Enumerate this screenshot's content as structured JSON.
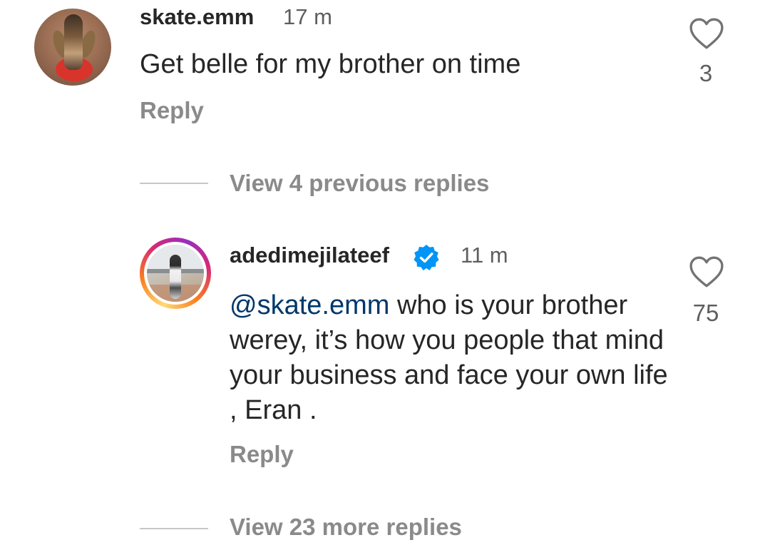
{
  "comments": [
    {
      "username": "skate.emm",
      "time": "17 m",
      "text": "Get belle for my brother on time",
      "reply_label": "Reply",
      "likes": "3",
      "verified": false
    },
    {
      "username": "adedimejilateef",
      "time": "11 m",
      "mention": "@skate.emm",
      "text": " who is your brother werey, it’s how you people that mind your business and face your own life , Eran .",
      "reply_label": "Reply",
      "likes": "75",
      "verified": true
    }
  ],
  "thread": {
    "view_previous_label": "View 4 previous replies",
    "view_more_label": "View 23 more replies"
  },
  "icons": {
    "like": "heart-outline-icon",
    "verified": "verified-badge-icon"
  },
  "colors": {
    "verified_blue": "#0095f6",
    "mention_link": "#00376b",
    "muted_text": "#8a8a8a"
  }
}
